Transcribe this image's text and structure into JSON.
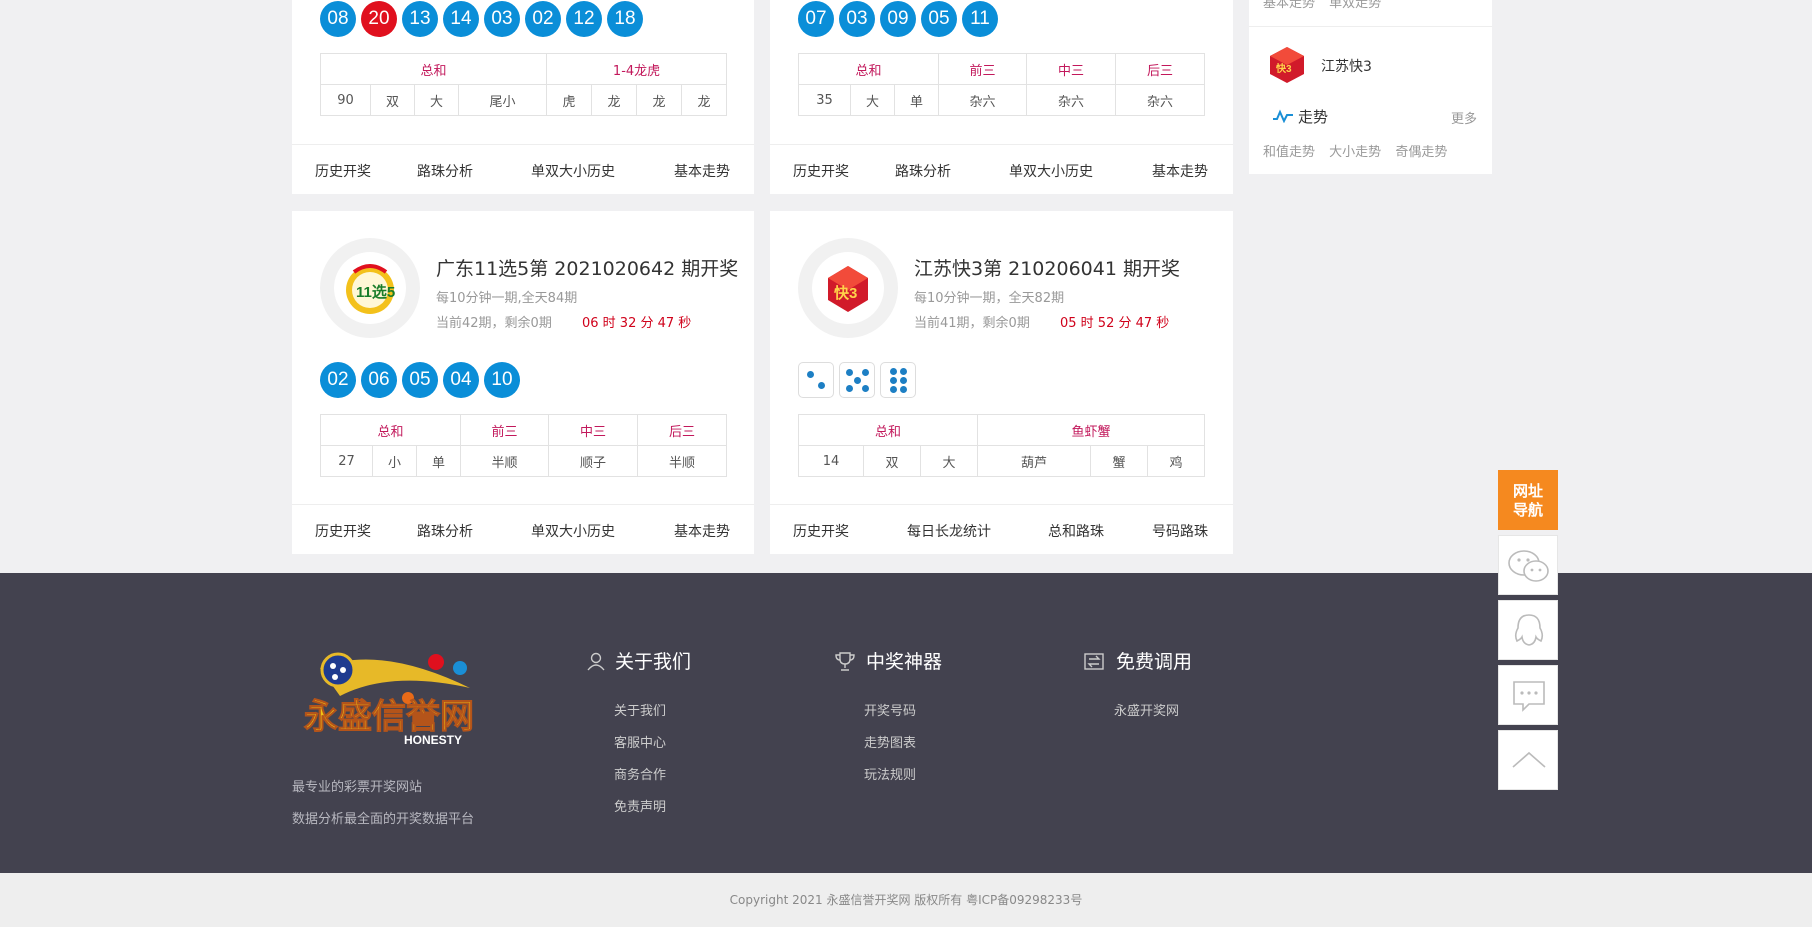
{
  "cards": {
    "top_left": {
      "balls": [
        "08",
        "20",
        "13",
        "14",
        "03",
        "02",
        "12",
        "18"
      ],
      "table_head": [
        "总和",
        "1-4龙虎"
      ],
      "table_row": [
        "90",
        "双",
        "大",
        "尾小",
        "虎",
        "龙",
        "龙",
        "龙"
      ],
      "links": [
        "历史开奖",
        "路珠分析",
        "单双大小历史",
        "基本走势"
      ]
    },
    "top_right": {
      "balls": [
        "07",
        "03",
        "09",
        "05",
        "11"
      ],
      "table_head": [
        "总和",
        "前三",
        "中三",
        "后三"
      ],
      "table_row": [
        "35",
        "大",
        "单",
        "杂六",
        "杂六",
        "杂六"
      ],
      "links": [
        "历史开奖",
        "路珠分析",
        "单双大小历史",
        "基本走势"
      ]
    },
    "bottom_left": {
      "title": "广东11选5第 2021020642 期开奖",
      "schedule": "每10分钟一期,全天84期",
      "progress": "当前42期，剩余0期",
      "countdown": "06 时 32 分 47 秒",
      "logo_text": "11选5",
      "balls": [
        "02",
        "06",
        "05",
        "04",
        "10"
      ],
      "table_head": [
        "总和",
        "前三",
        "中三",
        "后三"
      ],
      "table_row": [
        "27",
        "小",
        "单",
        "半顺",
        "顺子",
        "半顺"
      ],
      "links": [
        "历史开奖",
        "路珠分析",
        "单双大小历史",
        "基本走势"
      ]
    },
    "bottom_right": {
      "title": "江苏快3第 210206041 期开奖",
      "schedule": "每10分钟一期，全天82期",
      "progress": "当前41期，剩余0期",
      "countdown": "05 时 52 分 47 秒",
      "logo_text": "快3",
      "dice": [
        2,
        5,
        6
      ],
      "table_head": [
        "总和",
        "鱼虾蟹"
      ],
      "table_row": [
        "14",
        "双",
        "大",
        "葫芦",
        "蟹",
        "鸡"
      ],
      "links": [
        "历史开奖",
        "每日长龙统计",
        "总和路珠",
        "号码路珠"
      ]
    }
  },
  "sidebar": {
    "top_links": [
      "基本走势",
      "单双走势"
    ],
    "game_name": "江苏快3",
    "logo_text": "快3",
    "trend_label": "走势",
    "more_label": "更多",
    "trend_links": [
      "和值走势",
      "大小走势",
      "奇偶走势"
    ]
  },
  "footer": {
    "logo_main": "永盛信誉网",
    "logo_sub": "HONESTY",
    "slogans": [
      "最专业的彩票开奖网站",
      "数据分析最全面的开奖数据平台"
    ],
    "columns": [
      {
        "title": "关于我们",
        "icon": "user-icon",
        "items": [
          "关于我们",
          "客服中心",
          "商务合作",
          "免责声明"
        ]
      },
      {
        "title": "中奖神器",
        "icon": "trophy-icon",
        "items": [
          "开奖号码",
          "走势图表",
          "玩法规则"
        ]
      },
      {
        "title": "免费调用",
        "icon": "exchange-icon",
        "items": [
          "永盛开奖网"
        ]
      }
    ],
    "copyright": "Copyright 2021 永盛信誉开奖网 版权所有 粤ICP备09298233号"
  },
  "float_bar": {
    "nav_label_1": "网址",
    "nav_label_2": "导航",
    "icons": [
      "wechat-icon",
      "qq-icon",
      "message-icon",
      "back-to-top-icon"
    ]
  },
  "colors": {
    "ball_blue": "#0a8ed8",
    "ball_red": "#e0101e",
    "table_head": "#c2185b",
    "countdown": "#d0021b",
    "footer_bg": "#43424f",
    "nav_orange": "#f5891f"
  }
}
